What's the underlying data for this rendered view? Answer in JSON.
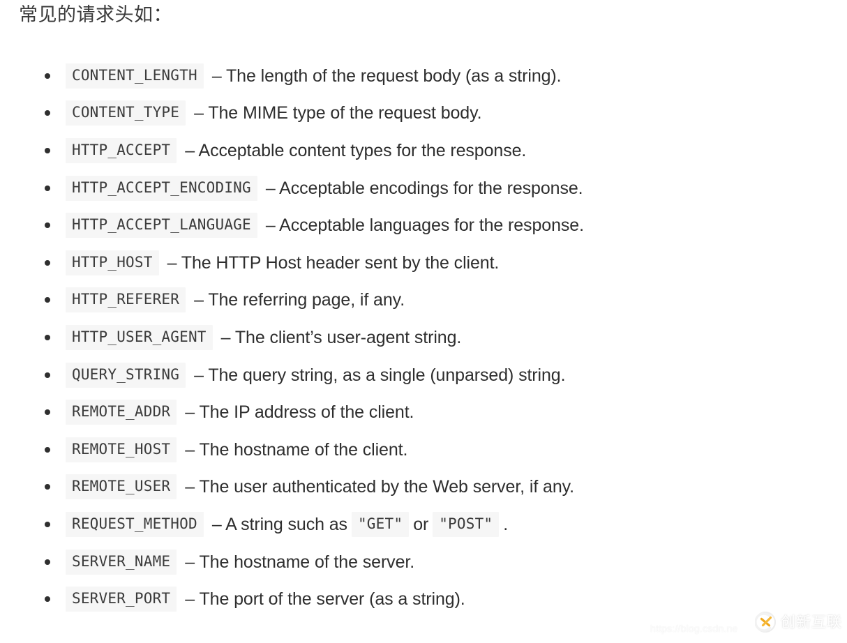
{
  "document": {
    "heading": "常见的请求头如：",
    "items": [
      {
        "code": "CONTENT_LENGTH",
        "desc": "– The length of the request body (as a string)."
      },
      {
        "code": "CONTENT_TYPE",
        "desc": "– The MIME type of the request body."
      },
      {
        "code": "HTTP_ACCEPT",
        "desc": "– Acceptable content types for the response."
      },
      {
        "code": "HTTP_ACCEPT_ENCODING",
        "desc": "– Acceptable encodings for the response."
      },
      {
        "code": "HTTP_ACCEPT_LANGUAGE",
        "desc": "– Acceptable languages for the response."
      },
      {
        "code": "HTTP_HOST",
        "desc": "– The HTTP Host header sent by the client."
      },
      {
        "code": "HTTP_REFERER",
        "desc": "– The referring page, if any."
      },
      {
        "code": "HTTP_USER_AGENT",
        "desc": "– The client’s user-agent string."
      },
      {
        "code": "QUERY_STRING",
        "desc": "– The query string, as a single (unparsed) string."
      },
      {
        "code": "REMOTE_ADDR",
        "desc": "– The IP address of the client."
      },
      {
        "code": "REMOTE_HOST",
        "desc": "– The hostname of the client."
      },
      {
        "code": "REMOTE_USER",
        "desc": "– The user authenticated by the Web server, if any."
      },
      {
        "code": "REQUEST_METHOD",
        "desc": "– A string such as",
        "code2": "\"GET\"",
        "desc2": "or",
        "code3": "\"POST\"",
        "desc3": "."
      },
      {
        "code": "SERVER_NAME",
        "desc": "– The hostname of the server."
      },
      {
        "code": "SERVER_PORT",
        "desc": "– The port of the server (as a string)."
      }
    ]
  },
  "watermark": {
    "url": "https://blog.csdn.ne",
    "brand": "创新互联",
    "mark_icon": "brand-c-swoosh-icon",
    "mark_accent": "#f0a81e",
    "mark_ring": "#e8e8e8"
  },
  "theme": {
    "page_background": "#ffffff",
    "text_color": "#2e2e2e",
    "code_background": "#f6f6f6",
    "code_text_color": "#3b3b3b",
    "bullet_color": "#2f2f2f"
  }
}
